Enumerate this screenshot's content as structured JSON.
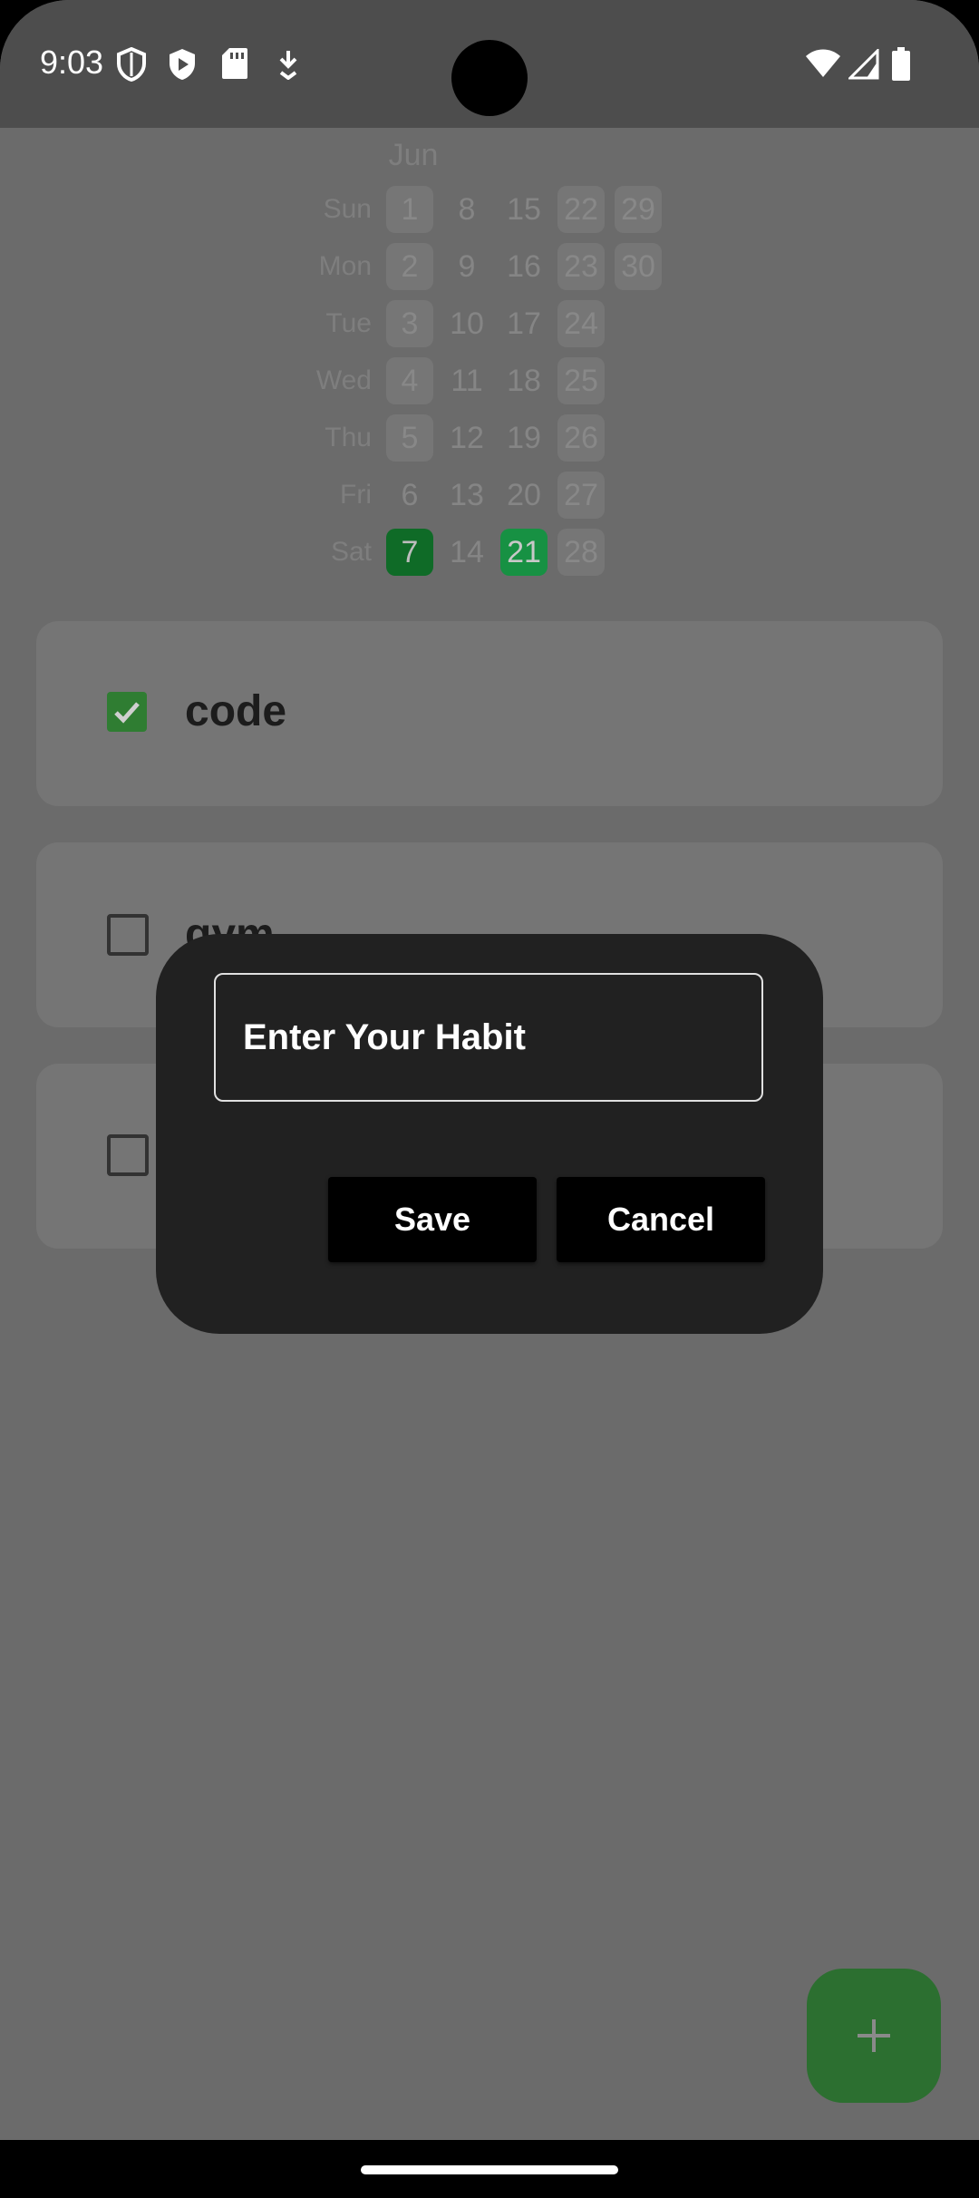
{
  "status_bar": {
    "time": "9:03"
  },
  "calendar": {
    "month": "Jun",
    "weekdays": [
      "Sun",
      "Mon",
      "Tue",
      "Wed",
      "Thu",
      "Fri",
      "Sat"
    ],
    "days": {
      "d1": "1",
      "d2": "2",
      "d3": "3",
      "d4": "4",
      "d5": "5",
      "d6": "6",
      "d7": "7",
      "d8": "8",
      "d9": "9",
      "d10": "10",
      "d11": "11",
      "d12": "12",
      "d13": "13",
      "d14": "14",
      "d15": "15",
      "d16": "16",
      "d17": "17",
      "d18": "18",
      "d19": "19",
      "d20": "20",
      "d21": "21",
      "d22": "22",
      "d23": "23",
      "d24": "24",
      "d25": "25",
      "d26": "26",
      "d27": "27",
      "d28": "28",
      "d29": "29",
      "d30": "30"
    },
    "completed_days": [
      7,
      21
    ]
  },
  "habits": [
    {
      "name": "code",
      "checked": true
    },
    {
      "name": "gym",
      "checked": false
    },
    {
      "name": "",
      "checked": false
    }
  ],
  "dialog": {
    "input_placeholder": "Enter Your Habit",
    "save_label": "Save",
    "cancel_label": "Cancel"
  },
  "fab": {
    "icon": "plus-icon"
  },
  "colors": {
    "completed_dark": "#0f6b27",
    "completed_light": "#179143",
    "checkbox_checked": "#2f7d32",
    "fab": "#2c6f30",
    "dialog_bg": "#212121"
  }
}
